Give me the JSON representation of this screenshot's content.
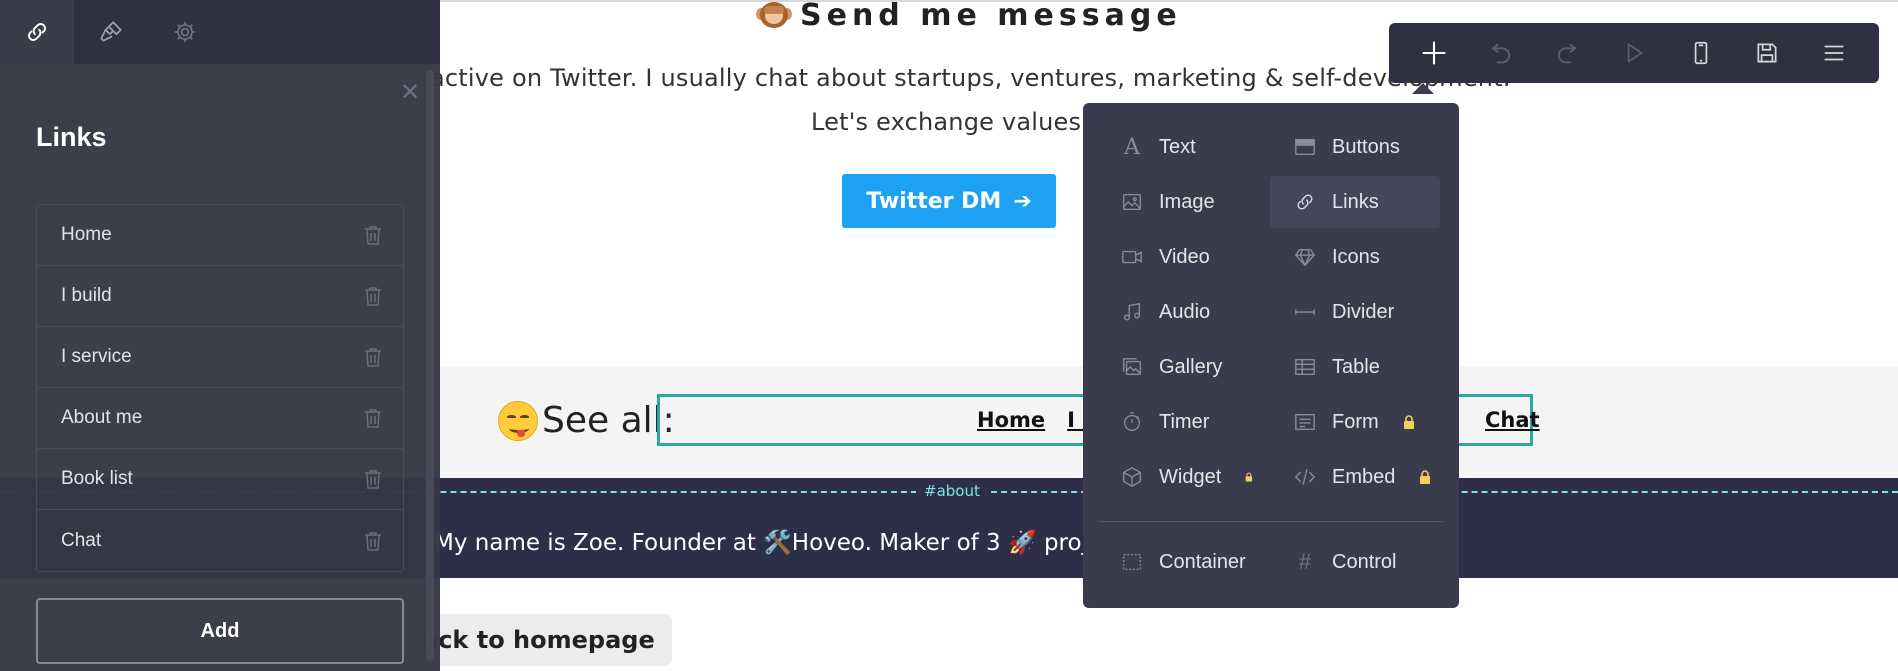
{
  "page": {
    "message_title": "Send me message",
    "paragraph_line1": "active on Twitter. I usually chat about startups, ventures, marketing & self-development.",
    "paragraph_line2": "Let's exchange values",
    "twitter_button": "Twitter DM",
    "see_all_label": "See all:",
    "nav_links": [
      "Home",
      "I bu"
    ],
    "nav_chat": "Chat",
    "about_tag": "#about",
    "about_text": "My name is Zoe. Founder at 🛠️Hoveo. Maker of 3 🚀 proje                                    ation.",
    "back_button": "ack to homepage"
  },
  "panel": {
    "title": "Links",
    "items": [
      {
        "label": "Home"
      },
      {
        "label": "I build"
      },
      {
        "label": "I service"
      },
      {
        "label": "About me"
      },
      {
        "label": "Book list"
      },
      {
        "label": "Chat"
      }
    ],
    "add_label": "Add"
  },
  "menu": {
    "items": [
      {
        "label": "Text",
        "icon": "text-icon"
      },
      {
        "label": "Buttons",
        "icon": "buttons-icon"
      },
      {
        "label": "Image",
        "icon": "image-icon"
      },
      {
        "label": "Links",
        "icon": "link-icon"
      },
      {
        "label": "Video",
        "icon": "video-icon"
      },
      {
        "label": "Icons",
        "icon": "diamond-icon"
      },
      {
        "label": "Audio",
        "icon": "music-note-icon"
      },
      {
        "label": "Divider",
        "icon": "divider-icon"
      },
      {
        "label": "Gallery",
        "icon": "gallery-icon"
      },
      {
        "label": "Table",
        "icon": "table-icon"
      },
      {
        "label": "Timer",
        "icon": "stopwatch-icon"
      },
      {
        "label": "Form",
        "icon": "form-icon"
      },
      {
        "label": "Widget",
        "icon": "cube-icon"
      },
      {
        "label": "Embed",
        "icon": "code-icon"
      },
      {
        "label": "Container",
        "icon": "dashed-square-icon"
      },
      {
        "label": "Control",
        "icon": "hash-icon"
      }
    ]
  },
  "colors": {
    "panel_bg": "#373846",
    "accent_teal": "#2ea7a2",
    "twitter_blue": "#1da1f2",
    "about_bg": "#2c2f47"
  }
}
